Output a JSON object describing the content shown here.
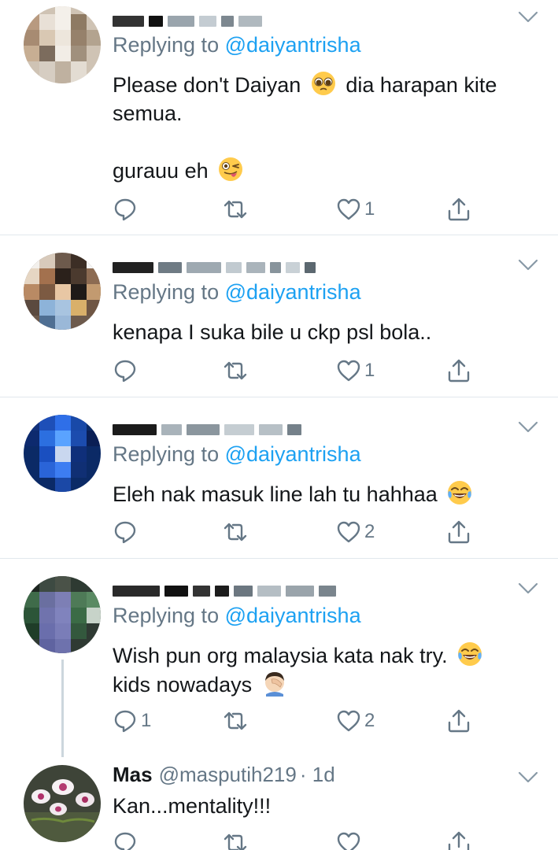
{
  "colors": {
    "accent": "#1da1f2",
    "secondary": "#657786",
    "divider": "#e1e8ed",
    "text": "#14171a"
  },
  "tweets": [
    {
      "author_name": "",
      "author_handle": "",
      "replying_prefix": "Replying to ",
      "replying_to": "@daiyantrisha",
      "lines": [
        "Please don't Daiyan ",
        " dia harapan kite",
        "semua.",
        "",
        "gurauu eh "
      ],
      "emojis": [
        "pleading-face",
        "winking-face-tongue"
      ],
      "reply_count": "",
      "like_count": "1"
    },
    {
      "author_name": "",
      "author_handle": "",
      "replying_prefix": "Replying to ",
      "replying_to": "@daiyantrisha",
      "lines": [
        "kenapa I suka bile u ckp psl bola.."
      ],
      "emojis": [],
      "reply_count": "",
      "like_count": "1"
    },
    {
      "author_name": "",
      "author_handle": "",
      "replying_prefix": "Replying to ",
      "replying_to": "@daiyantrisha",
      "lines": [
        "Eleh nak masuk line lah tu hahhaa "
      ],
      "emojis": [
        "tears-of-joy"
      ],
      "reply_count": "",
      "like_count": "2"
    },
    {
      "author_name": "",
      "author_handle": "",
      "replying_prefix": "Replying to ",
      "replying_to": "@daiyantrisha",
      "lines": [
        "Wish pun org malaysia kata nak try. ",
        "kids nowadays "
      ],
      "emojis": [
        "tears-of-joy",
        "facepalm"
      ],
      "reply_count": "1",
      "like_count": "2"
    },
    {
      "author_name": "Mas",
      "author_handle": "@masputih219",
      "time": "· 1d",
      "lines": [
        "Kan...mentality!!!"
      ],
      "emojis": [],
      "reply_count": "",
      "like_count": ""
    }
  ]
}
